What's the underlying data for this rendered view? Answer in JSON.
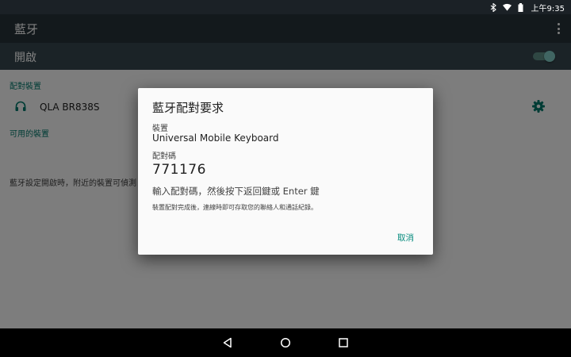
{
  "status_bar": {
    "icons": [
      "bluetooth-icon",
      "wifi-icon",
      "battery-icon"
    ],
    "time": "上午9:35"
  },
  "app_bar": {
    "title": "藍牙",
    "overflow_icon": "more-vert-icon"
  },
  "bluetooth_switch": {
    "label": "開啟",
    "state": "on"
  },
  "paired_section": {
    "header": "配對裝置",
    "devices": [
      {
        "name": "QLA BR838S",
        "icon": "headset-icon",
        "settings_icon": "gear-icon"
      }
    ]
  },
  "available_section": {
    "header": "可用的裝置"
  },
  "hint": "藍牙設定開啟時，附近的裝置可偵測",
  "dialog": {
    "title": "藍牙配對要求",
    "device_label": "裝置",
    "device_name": "Universal Mobile Keyboard",
    "code_label": "配對碼",
    "code": "771176",
    "instruction": "輸入配對碼，然後按下返回鍵或 Enter 鍵",
    "note": "裝置配對完成後，連線時即可存取您的聯絡人和通話紀錄。",
    "cancel_label": "取消"
  },
  "nav_bar": {
    "buttons": [
      "back-icon",
      "home-icon",
      "recents-icon"
    ]
  },
  "colors": {
    "accent": "#00897b",
    "app_bar": "#263238",
    "switch_bar": "#37474f"
  }
}
